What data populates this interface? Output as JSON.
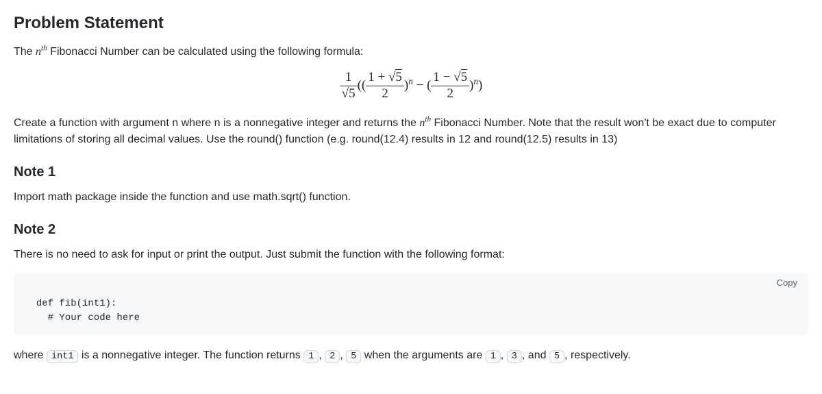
{
  "heading1": "Problem Statement",
  "intro_a": "The ",
  "intro_b": " Fibonacci Number can be calculated using the following formula:",
  "nth_n": "n",
  "nth_th": "th",
  "formula_parts": {
    "one": "1",
    "surd": "√",
    "five": "5",
    "two": "2",
    "plus": " + ",
    "minus_inner": " − ",
    "minus_outer": " − (",
    "lparen": "((",
    "rparen": ")",
    "exp": "n"
  },
  "task_a": "Create a function with argument n where n is a nonnegative integer and returns the ",
  "task_b": " Fibonacci Number. Note that the result won't be exact due to computer limitations of storing all decimal values. Use the round() function (e.g. round(12.4) results in 12 and round(12.5) results in 13)",
  "note1_h": "Note 1",
  "note1_p": "Import math package inside the function and use math.sqrt() function.",
  "note2_h": "Note 2",
  "note2_p": "There is no need to ask for input or print the output. Just submit the function with the following format:",
  "code": "def fib(int1):\n    # Your code here",
  "copy": "Copy",
  "trail_a": "where ",
  "trail_b": " is a nonnegative integer. The function returns ",
  "trail_c": " when the arguments are ",
  "trail_d": ", and ",
  "trail_e": ", respectively.",
  "sep": ", ",
  "c_int1": "int1",
  "c_1": "1",
  "c_2": "2",
  "c_3": "3",
  "c_5": "5"
}
